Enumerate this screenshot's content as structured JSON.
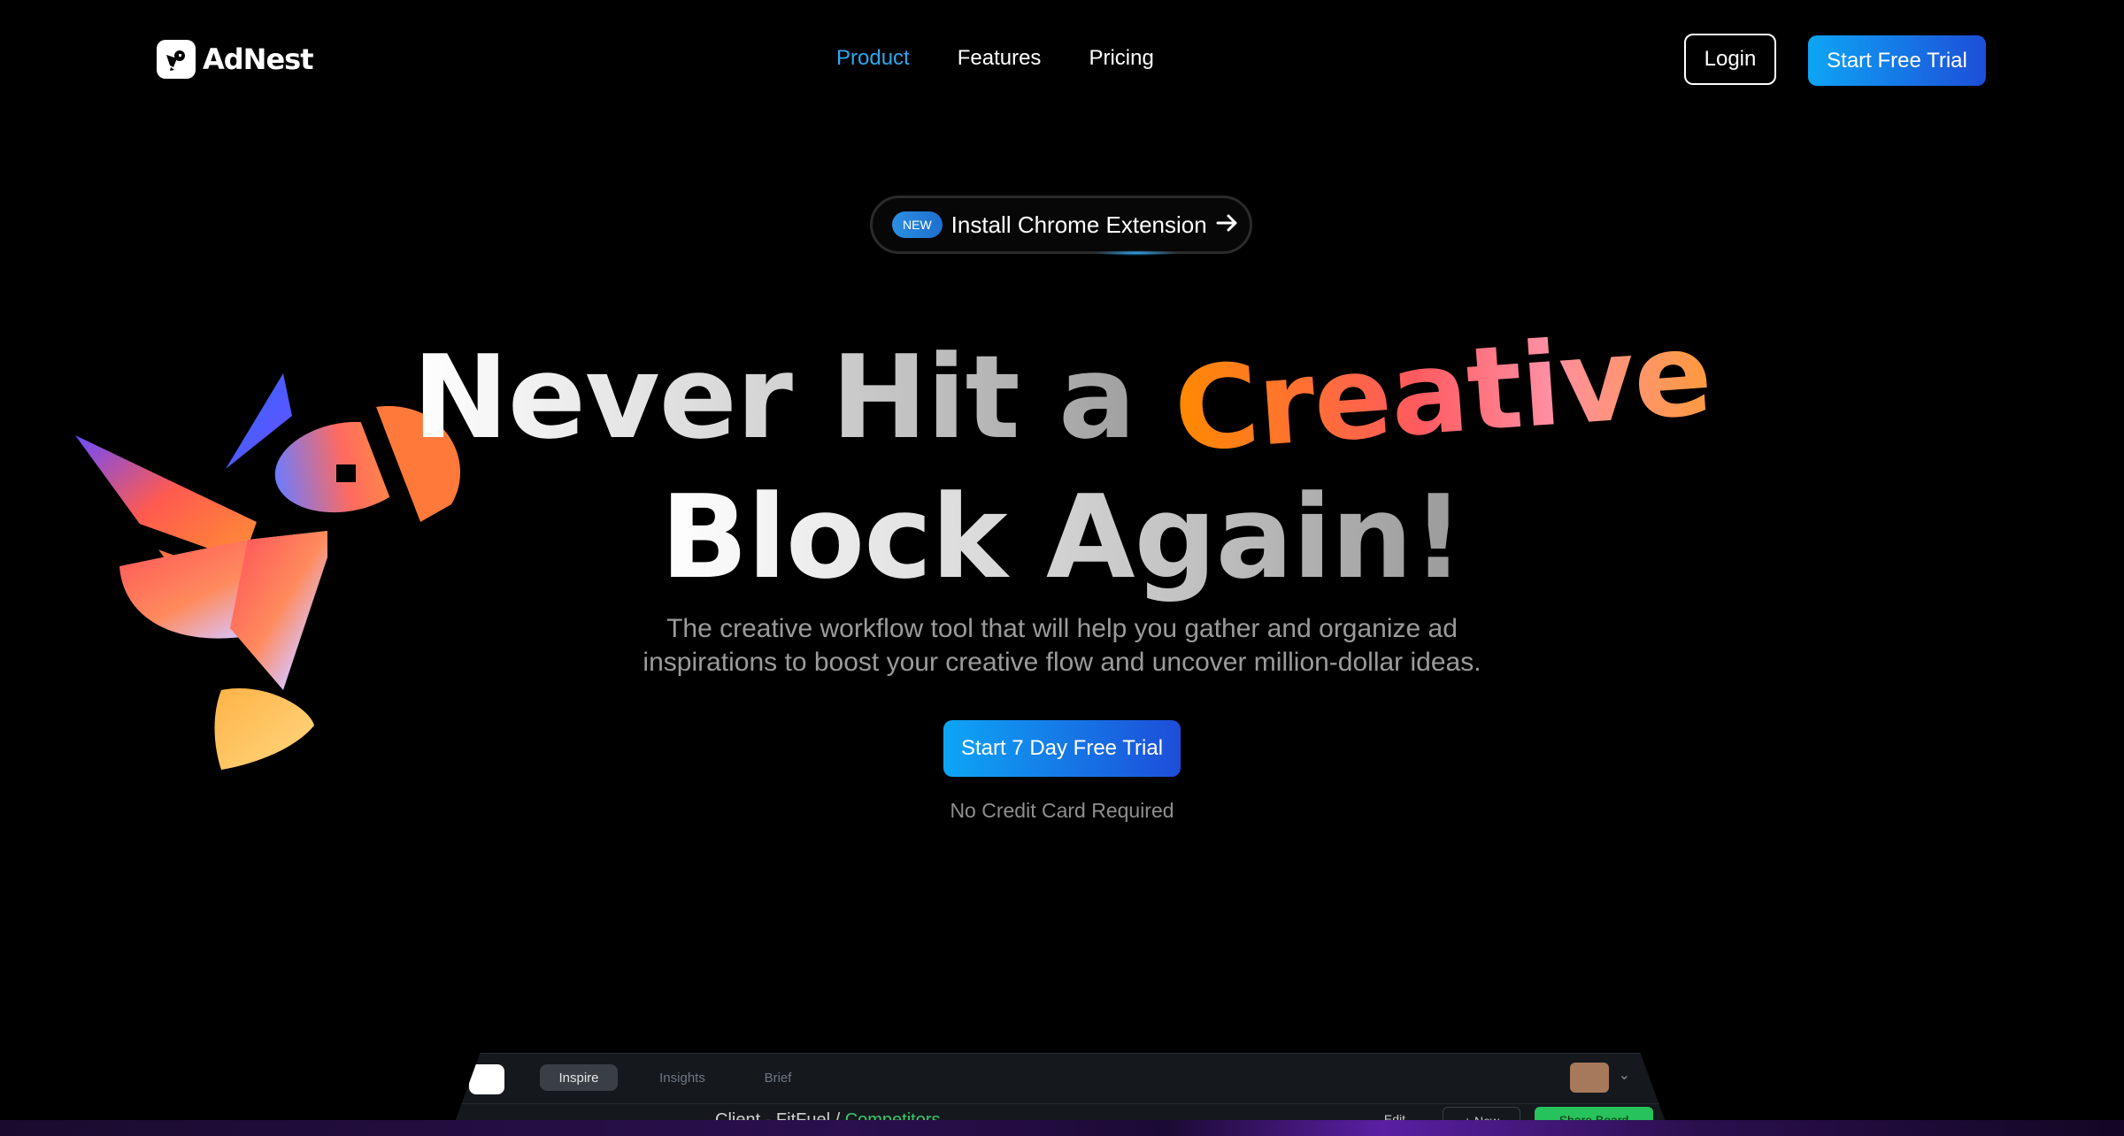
{
  "nav": {
    "logo_text": "AdNest",
    "links": [
      {
        "label": "Product",
        "active": true
      },
      {
        "label": "Features",
        "active": false
      },
      {
        "label": "Pricing",
        "active": false
      }
    ],
    "login_label": "Login",
    "trial_label": "Start Free Trial"
  },
  "announcement": {
    "badge": "NEW",
    "label": "Install Chrome Extension",
    "arrow": "→"
  },
  "hero": {
    "headline_part1": "Never Hit a ",
    "headline_highlight": "Creative",
    "headline_part2": "Block Again!",
    "subtitle_line1": "The creative workflow tool that will help you gather and organize ad",
    "subtitle_line2": "inspirations to boost your creative flow and uncover million-dollar ideas.",
    "cta_label": "Start 7 Day Free Trial",
    "note": "No Credit Card Required"
  },
  "preview": {
    "tabs": [
      "Inspire",
      "Insights",
      "Brief"
    ],
    "breadcrumb_prefix": "Client - FitFuel / ",
    "breadcrumb_link": "Competitors",
    "edit_label": "Edit",
    "new_label": "+ New",
    "green_label": "Share Board"
  },
  "colors": {
    "accent": "#2ea7f0",
    "button_gradient_start": "#0ea5f5",
    "button_gradient_end": "#1d4ed8",
    "background": "#000000"
  },
  "icons": {
    "logo": "bird-logo-icon",
    "arrow": "arrow-right-icon",
    "chevron": "chevron-down-icon"
  }
}
